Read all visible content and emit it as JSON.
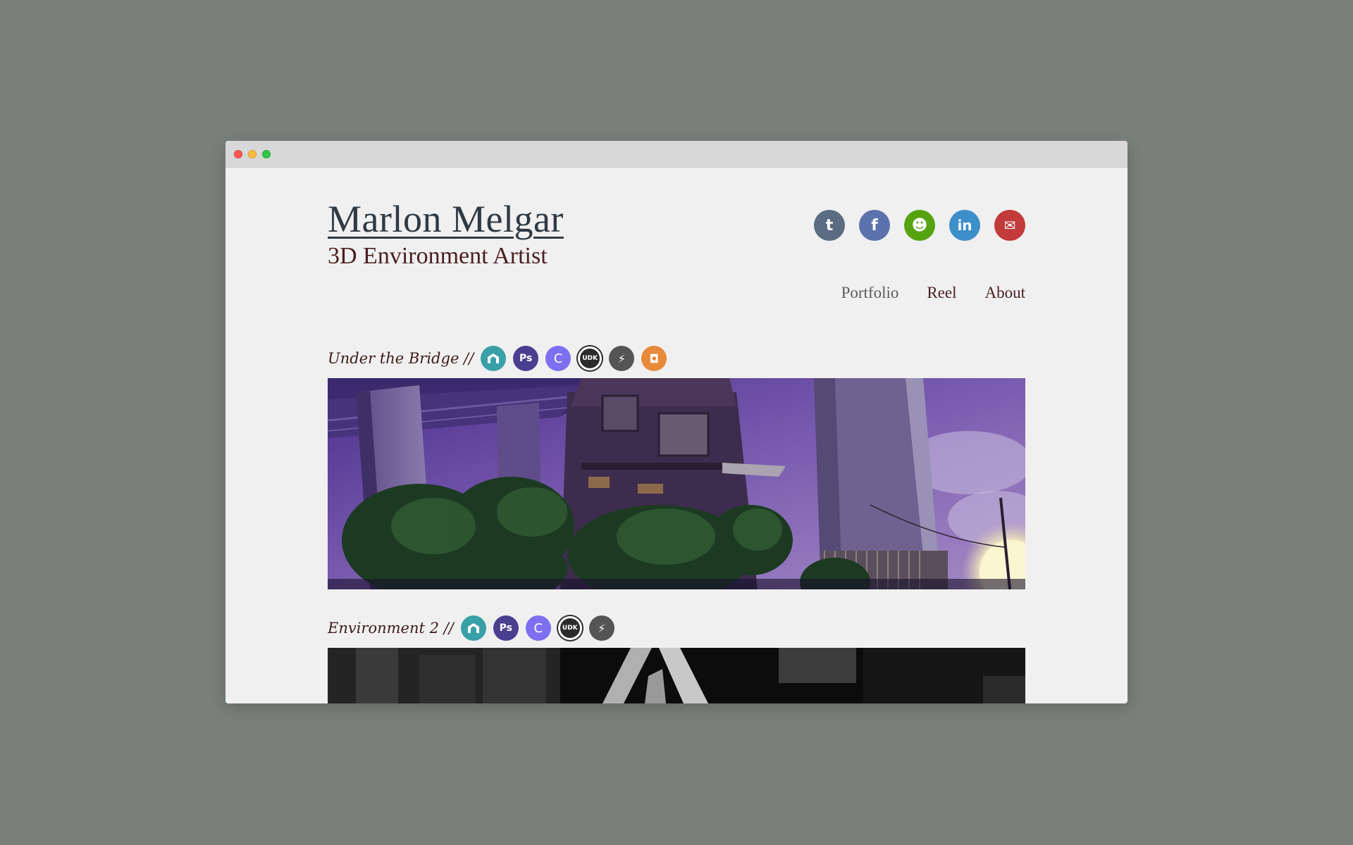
{
  "site": {
    "title": "Marlon Melgar",
    "subtitle": "3D Environment Artist"
  },
  "social": [
    {
      "icon": "tumblr-icon",
      "glyph": "t",
      "color": "#5a6c82"
    },
    {
      "icon": "facebook-icon",
      "glyph": "f",
      "color": "#5c72ac"
    },
    {
      "icon": "smiley-icon",
      "glyph": "☻",
      "color": "#56a312"
    },
    {
      "icon": "linkedin-icon",
      "glyph": "in",
      "color": "#3d8fc9"
    },
    {
      "icon": "email-icon",
      "glyph": "✉",
      "color": "#c23a3a"
    }
  ],
  "nav": {
    "portfolio": "Portfolio",
    "reel": "Reel",
    "about": "About",
    "active_color": "#5b5b5b",
    "color": "#4a1f1f"
  },
  "projects": [
    {
      "title": "Under the Bridge //",
      "tools": [
        {
          "icon": "3dsmax-icon",
          "glyph": "⌂",
          "color": "#3aa0a8"
        },
        {
          "icon": "photoshop-icon",
          "glyph": "Ps",
          "color": "#4a3f8f"
        },
        {
          "icon": "crazybump-icon",
          "glyph": "C",
          "color": "#7c6ff0"
        },
        {
          "icon": "udk-icon",
          "glyph": "UDK",
          "color": "#2b2b2b"
        },
        {
          "icon": "zbrush-icon",
          "glyph": "⚡",
          "color": "#555555"
        },
        {
          "icon": "substance-icon",
          "glyph": "◘",
          "color": "#e88a3a"
        }
      ]
    },
    {
      "title": "Environment 2 //",
      "tools": [
        {
          "icon": "3dsmax-icon",
          "glyph": "⌂",
          "color": "#3aa0a8"
        },
        {
          "icon": "photoshop-icon",
          "glyph": "Ps",
          "color": "#4a3f8f"
        },
        {
          "icon": "crazybump-icon",
          "glyph": "C",
          "color": "#7c6ff0"
        },
        {
          "icon": "udk-icon",
          "glyph": "UDK",
          "color": "#2b2b2b"
        },
        {
          "icon": "zbrush-icon",
          "glyph": "⚡",
          "color": "#555555"
        }
      ]
    }
  ]
}
